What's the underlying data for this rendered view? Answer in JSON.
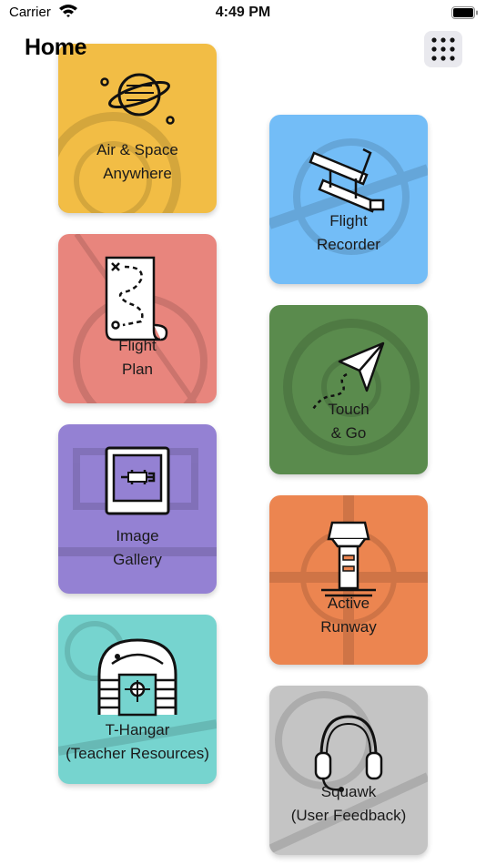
{
  "status_bar": {
    "carrier": "Carrier",
    "time": "4:49 PM"
  },
  "header": {
    "title": "Home"
  },
  "tiles": [
    {
      "line1": "Air & Space",
      "line2": "Anywhere",
      "color": "#f2bd45",
      "icon": "planet-icon"
    },
    {
      "line1": "Flight",
      "line2": "Recorder",
      "color": "#73bdf7",
      "icon": "biplane-icon"
    },
    {
      "line1": "Flight",
      "line2": "Plan",
      "color": "#e8857d",
      "icon": "map-scroll-icon"
    },
    {
      "line1": "Touch",
      "line2": "& Go",
      "color": "#5a8b4d",
      "icon": "paper-plane-icon"
    },
    {
      "line1": "Image",
      "line2": "Gallery",
      "color": "#9481d3",
      "icon": "photo-frame-icon"
    },
    {
      "line1": "Active",
      "line2": "Runway",
      "color": "#ec8550",
      "icon": "control-tower-icon"
    },
    {
      "line1": "T-Hangar",
      "line2": "(Teacher Resources)",
      "color": "#76d4cf",
      "icon": "hangar-icon"
    },
    {
      "line1": "Squawk",
      "line2": "(User Feedback)",
      "color": "#c4c4c4",
      "icon": "headset-icon"
    }
  ]
}
